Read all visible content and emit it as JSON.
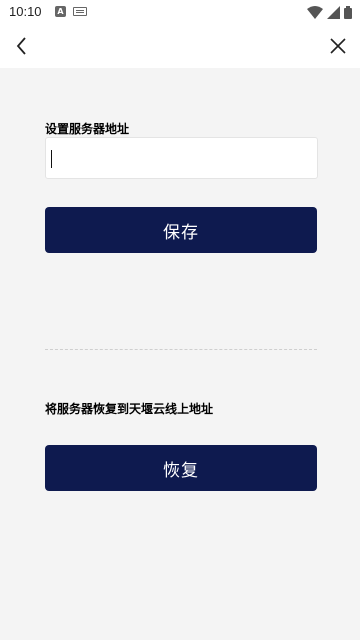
{
  "status_bar": {
    "time": "10:10",
    "icon_a": "A",
    "icons": [
      "notification-a-icon",
      "keyboard-icon",
      "wifi-icon",
      "signal-icon",
      "battery-icon"
    ]
  },
  "app_bar": {
    "back_icon": "chevron-left-icon",
    "close_icon": "close-icon"
  },
  "server_address": {
    "label": "设置服务器地址",
    "value": "",
    "placeholder": "",
    "save_label": "保存"
  },
  "restore": {
    "label": "将服务器恢复到天堰云线上地址",
    "button_label": "恢复"
  },
  "colors": {
    "primary": "#0e1a4f",
    "background": "#f4f4f4"
  }
}
